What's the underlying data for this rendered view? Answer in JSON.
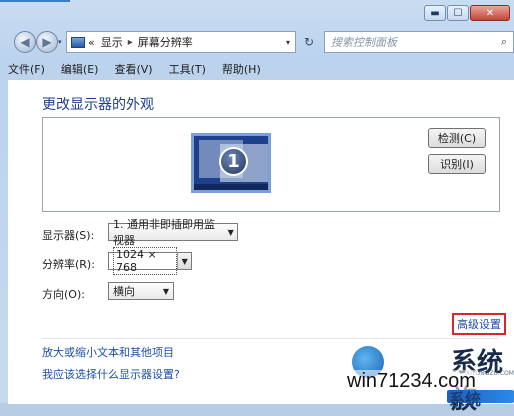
{
  "window": {
    "caption": {
      "minimize": "▬",
      "maximize": "☐",
      "close": "✕"
    }
  },
  "nav": {
    "back_icon": "arrow-left-icon",
    "forward_icon": "arrow-right-icon",
    "chevron": "«",
    "breadcrumb": [
      "显示",
      "屏幕分辨率"
    ],
    "separator": "▸",
    "dropdown": "▾",
    "refresh": "↻",
    "search_placeholder": "搜索控制面板",
    "search_icon": "⌕"
  },
  "menu": [
    "文件(F)",
    "编辑(E)",
    "查看(V)",
    "工具(T)",
    "帮助(H)"
  ],
  "main": {
    "title": "更改显示器的外观",
    "monitor_number": "1",
    "detect_button": "检测(C)",
    "identify_button": "识别(I)",
    "display": {
      "label": "显示器(S):",
      "value": "1. 通用非即插即用监视器"
    },
    "resolution": {
      "label": "分辨率(R):",
      "value": "1024 × 768"
    },
    "orientation": {
      "label": "方向(O):",
      "value": "横向"
    },
    "advanced_link": "高级设置",
    "link_text_size": "放大或缩小文本和其他项目",
    "link_which_settings": "我应该选择什么显示器设置?"
  },
  "watermark": {
    "url": "win71234.com",
    "big_text": "系统族",
    "small_text": "XITONGZU.COM",
    "bottom_text": "系统"
  },
  "colors": {
    "title_blue": "#1e3e8a",
    "link_blue": "#1d4fa5",
    "highlight_red": "#d8262b",
    "close_red": "#c3453a"
  }
}
